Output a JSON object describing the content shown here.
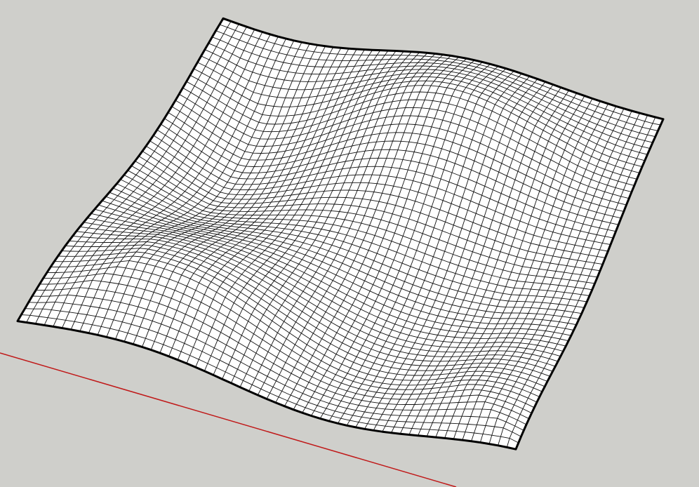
{
  "viewport": {
    "background_color": "#cfcfcb",
    "surface_fill_color": "#ffffff",
    "wire_color": "#111111",
    "outline_color": "#000000",
    "axis_color": "#c01818"
  },
  "surface": {
    "kind": "wavy-mesh-surface",
    "grid_rows": 56,
    "grid_cols": 56
  },
  "axes": {
    "red_axis": {
      "name": "red-axis",
      "visible": true
    }
  }
}
